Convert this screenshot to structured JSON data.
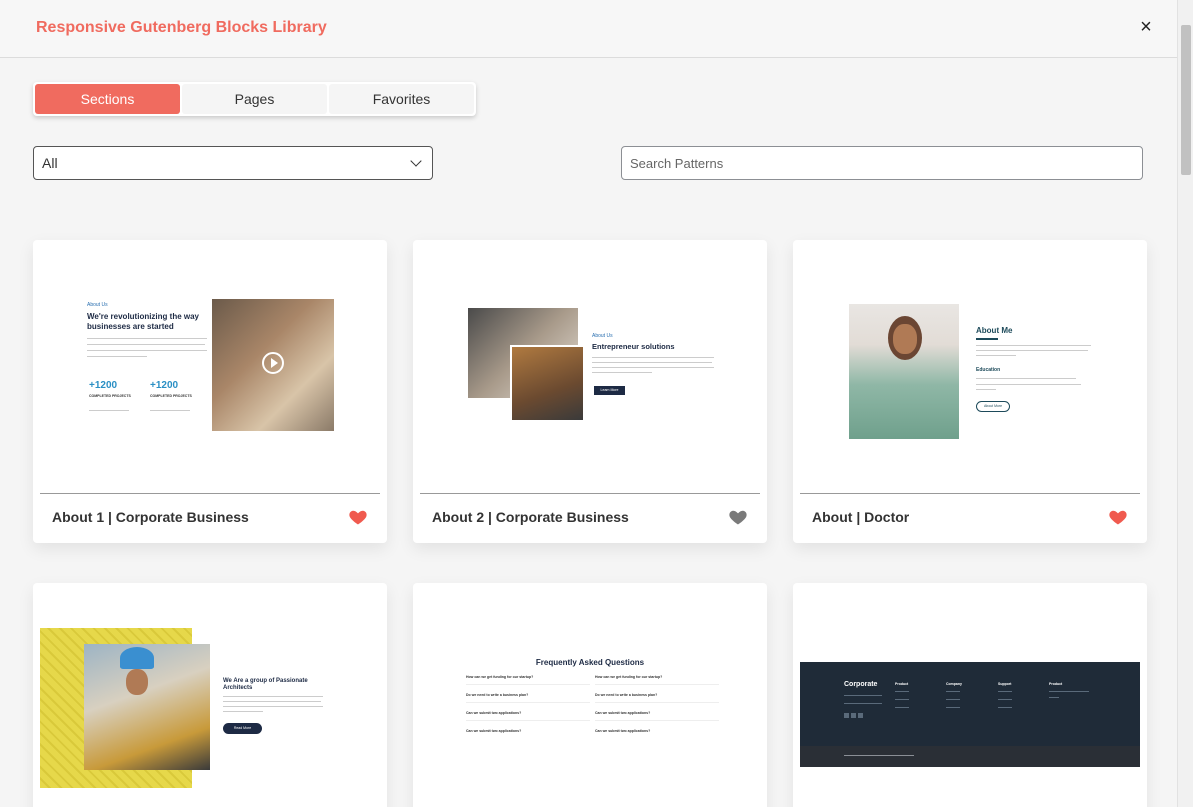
{
  "header": {
    "title": "Responsive Gutenberg Blocks Library",
    "close_label": "×"
  },
  "tabs": [
    {
      "label": "Sections",
      "active": true
    },
    {
      "label": "Pages",
      "active": false
    },
    {
      "label": "Favorites",
      "active": false
    }
  ],
  "filter": {
    "selected": "All"
  },
  "search": {
    "placeholder": "Search Patterns",
    "value": ""
  },
  "colors": {
    "accent": "#f06b5f",
    "favorite": "#f05a4f",
    "not_favorite": "#7a7a7a"
  },
  "cards": [
    {
      "title": "About 1 | Corporate Business",
      "favorite": true,
      "preview": {
        "kicker": "About Us",
        "heading1": "We're revolutionizing the way",
        "heading2": "businesses are started",
        "stat1": "+1200",
        "stat1_label": "COMPLETED PROJECTS",
        "stat2": "+1200",
        "stat2_label": "COMPLETED PROJECTS"
      }
    },
    {
      "title": "About 2 | Corporate Business",
      "favorite": false,
      "preview": {
        "kicker": "About Us",
        "heading": "Entrepreneur solutions",
        "button": "Learn More"
      }
    },
    {
      "title": "About | Doctor",
      "favorite": true,
      "preview": {
        "heading": "About Me",
        "subheading": "Education",
        "button": "About More"
      }
    },
    {
      "title": "",
      "favorite": false,
      "preview": {
        "heading1": "We Are a group of Passionate",
        "heading2": "Architects",
        "button": "Read More"
      }
    },
    {
      "title": "",
      "favorite": false,
      "preview": {
        "heading": "Frequently Asked Questions",
        "questions": [
          "How can we get funding for our startup?",
          "How can we get funding for our startup?",
          "Do we need to write a business plan?",
          "Do we need to write a business plan?",
          "Can we submit two applications?",
          "Can we submit two applications?",
          "Can we submit two applications?",
          "Can we submit two applications?"
        ]
      }
    },
    {
      "title": "",
      "favorite": false,
      "preview": {
        "brand": "Corporate",
        "col1": "Product",
        "col2": "Company",
        "col3": "Support",
        "col4": "Product"
      }
    }
  ]
}
